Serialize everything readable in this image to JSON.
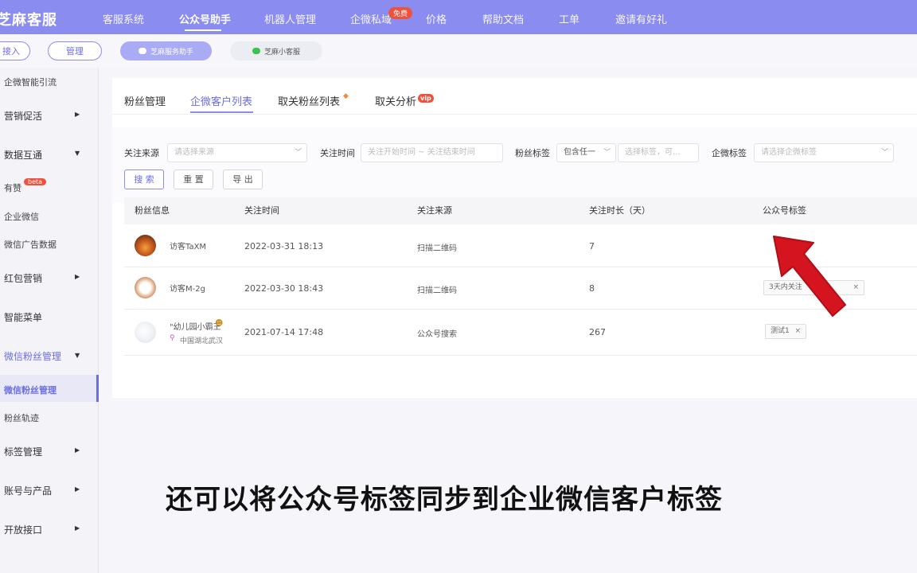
{
  "topnav": {
    "logo": "芝麻客服",
    "items": [
      "客服系统",
      "公众号助手",
      "机器人管理",
      "企微私域",
      "价格",
      "帮助文档",
      "工单",
      "邀请有好礼"
    ],
    "free_badge": "免费"
  },
  "subbar": {
    "access": "接入",
    "manage": "管理",
    "account1": "芝麻服务助手",
    "account2": "芝麻小客服"
  },
  "sidebar": {
    "items": [
      "企微智能引流",
      "营销促活",
      "数据互通",
      "有赞",
      "企业微信",
      "微信广告数据",
      "红包营销",
      "智能菜单",
      "微信粉丝管理",
      "微信粉丝管理",
      "粉丝轨迹",
      "标签管理",
      "账号与产品",
      "开放接口"
    ],
    "beta": "beta"
  },
  "tabs": {
    "items": [
      "粉丝管理",
      "企微客户列表",
      "取关粉丝列表",
      "取关分析"
    ],
    "vip": "vip"
  },
  "filters": {
    "source_label": "关注来源",
    "source_placeholder": "请选择来源",
    "time_label": "关注时间",
    "time_placeholder": "关注开始时间 ~ 关注结束时间",
    "tag_label": "粉丝标签",
    "tag_mode": "包含任一",
    "tag_placeholder": "选择标签，可...",
    "wecom_label": "企微标签",
    "wecom_placeholder": "请选择企微标签",
    "search": "搜 索",
    "reset": "重 置",
    "export": "导 出"
  },
  "table": {
    "headers": [
      "粉丝信息",
      "关注时间",
      "关注来源",
      "关注时长（天）",
      "公众号标签"
    ],
    "rows": [
      {
        "name": "访客TaXM",
        "time": "2022-03-31 18:13",
        "source": "扫描二维码",
        "days": "7",
        "tags": []
      },
      {
        "name": "访客M-2g",
        "time": "2022-03-30 18:43",
        "source": "扫描二维码",
        "days": "8",
        "tags": [
          "3天内关注"
        ]
      },
      {
        "name": "\"幼儿园小霸王",
        "location": "中国湖北武汉",
        "time": "2021-07-14 17:48",
        "source": "公众号搜索",
        "days": "267",
        "tags": [
          "测试1"
        ]
      }
    ]
  },
  "caption": "还可以将公众号标签同步到企业微信客户标签",
  "colors": {
    "accent": "#8a8cf0",
    "badge": "#f0513d",
    "arrow": "#d4141f"
  }
}
